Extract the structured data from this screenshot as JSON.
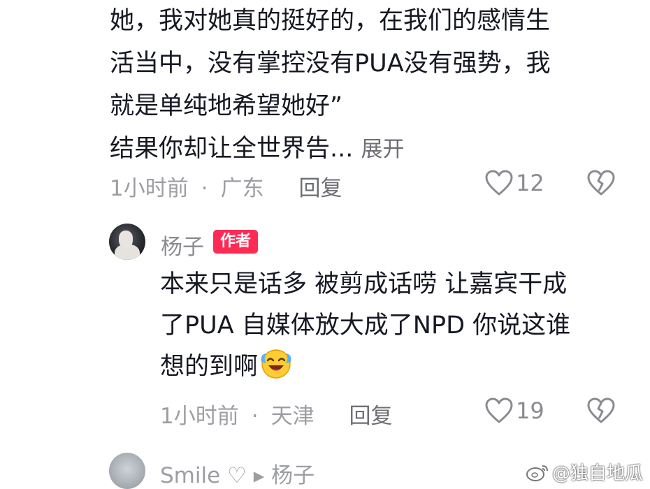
{
  "comment1": {
    "lines": [
      "她，我对她真的挺好的，在我们的感情生",
      "活当中，没有掌控没有PUA没有强势，我",
      "就是单纯地希望她好”"
    ],
    "last_line": "结果你却让全世界告...",
    "expand_label": "展开",
    "time": "1小时前",
    "separator": "·",
    "location": "广东",
    "reply_label": "回复",
    "like_count": "12",
    "icons": {
      "like": "heart-outline-icon",
      "dislike": "broken-heart-icon"
    }
  },
  "reply1": {
    "username": "杨子",
    "author_badge": "作者",
    "lines": [
      "本来只是话多 被剪成话唠 让嘉宾干成",
      "了PUA 自媒体放大成了NPD 你说这谁",
      "想的到啊"
    ],
    "emoji": "laughing-crying-emoji",
    "time": "1小时前",
    "separator": "·",
    "location": "天津",
    "reply_label": "回复",
    "like_count": "19",
    "icons": {
      "like": "heart-outline-icon",
      "dislike": "broken-heart-icon"
    }
  },
  "reply2_partial": {
    "username": "Smile",
    "arrow": "▸",
    "reply_to": "杨子"
  },
  "watermark": {
    "text": "@独自地瓜",
    "icon": "weibo-logo-icon"
  },
  "colors": {
    "text": "#161823",
    "meta": "#9d9ea3",
    "author_badge_bg": "#fe2c55"
  }
}
